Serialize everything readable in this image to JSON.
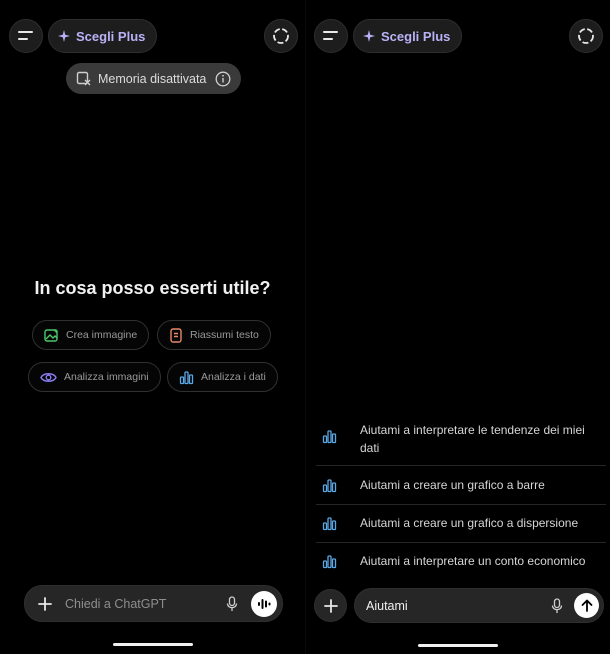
{
  "left": {
    "plus_button": {
      "label": "Scegli Plus"
    },
    "memory": {
      "label": "Memoria disattivata"
    },
    "heading": "In cosa posso esserti utile?",
    "chips": [
      {
        "label": "Crea immagine",
        "icon": "image-spark-icon",
        "color": "#4cc86a"
      },
      {
        "label": "Riassumi testo",
        "icon": "document-icon",
        "color": "#e8896b"
      },
      {
        "label": "Analizza immagini",
        "icon": "eye-icon",
        "color": "#8a7cf0"
      },
      {
        "label": "Analizza i dati",
        "icon": "bar-chart-icon",
        "color": "#5aa9e6"
      }
    ],
    "composer": {
      "placeholder": "Chiedi a ChatGPT"
    }
  },
  "right": {
    "plus_button": {
      "label": "Scegli Plus"
    },
    "suggestions": [
      {
        "label": "Aiutami a interpretare le tendenze dei miei dati",
        "icon": "bar-chart-icon"
      },
      {
        "label": "Aiutami a creare un grafico a barre",
        "icon": "bar-chart-icon"
      },
      {
        "label": "Aiutami a creare un grafico a dispersione",
        "icon": "bar-chart-icon"
      },
      {
        "label": "Aiutami a interpretare un conto economico",
        "icon": "bar-chart-icon"
      }
    ],
    "composer": {
      "value": "Aiutami"
    }
  },
  "colors": {
    "accent_plus": "#b9b2f6",
    "chart_icon": "#5aa9e6"
  }
}
